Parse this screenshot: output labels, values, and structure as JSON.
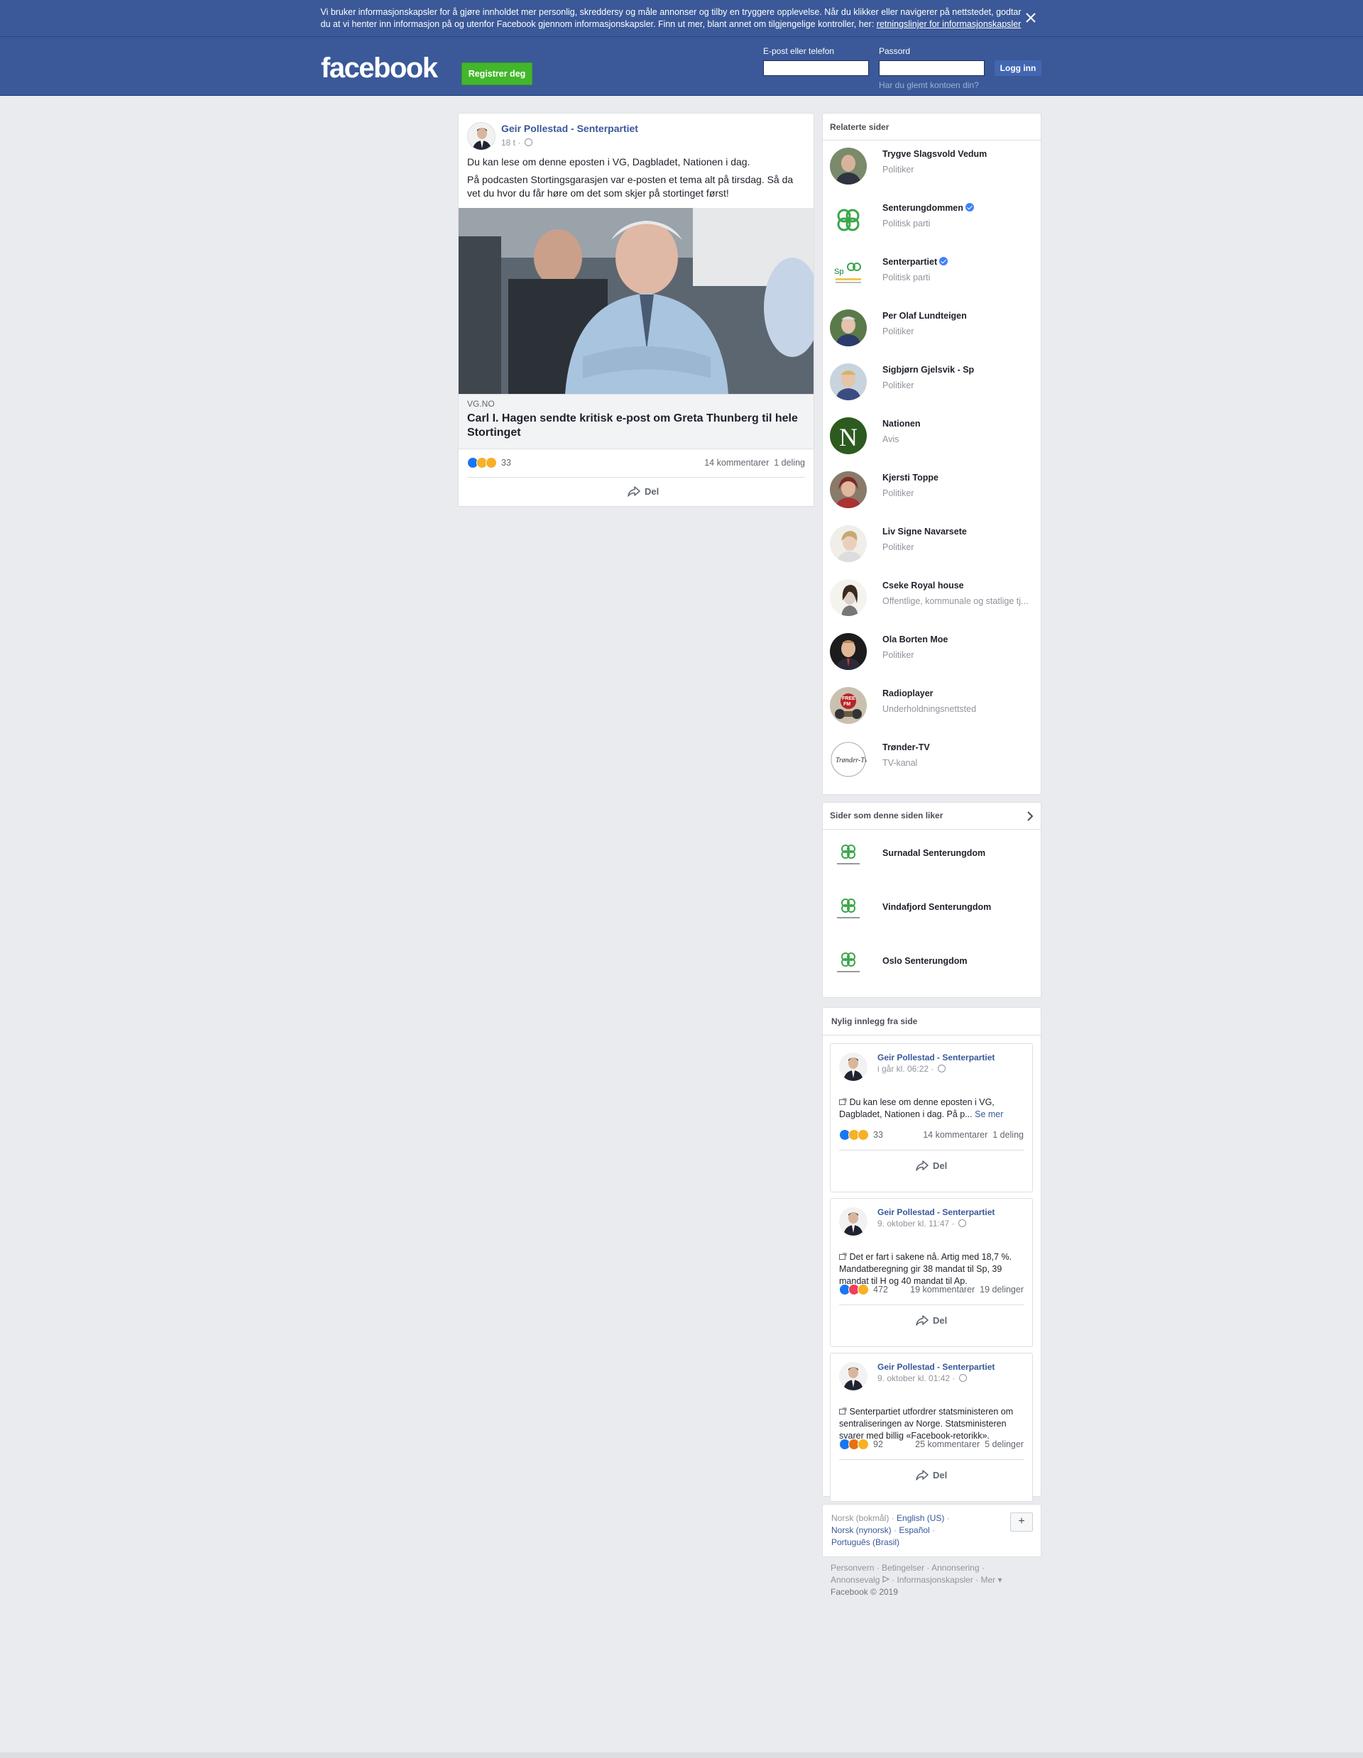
{
  "cookie_banner": {
    "text": "Vi bruker informasjonskapsler for å gjøre innholdet mer personlig, skreddersy og måle annonser og tilby en tryggere opplevelse. Når du klikker eller navigerer på nettstedet, godtar du at vi henter inn informasjon på og utenfor Facebook gjennom informasjonskapsler. Finn ut mer, blant annet om tilgjengelige kontroller, her: ",
    "link": "retningslinjer for informasjonskapsler"
  },
  "header": {
    "logo": "facebook",
    "register_label": "Registrer deg",
    "email_label": "E-post eller telefon",
    "password_label": "Passord",
    "login_label": "Logg inn",
    "forgot_label": "Har du glemt kontoen din?"
  },
  "post": {
    "author": "Geir Pollestad - Senterpartiet",
    "time": "18 t ·",
    "text1": "Du kan lese om denne eposten i VG, Dagbladet, Nationen i dag.",
    "text2": "På podcasten Stortingsgarasjen var e-posten et tema alt på tirsdag. Så da vet du hvor du får høre om det som skjer på stortinget først!",
    "link_domain": "VG.NO",
    "link_title": "Carl I. Hagen sendte kritisk e-post om Greta Thunberg til hele Stortinget",
    "reaction_count": "33",
    "comments": "14 kommentarer",
    "shares": "1 deling",
    "share_label": "Del"
  },
  "related": {
    "title": "Relaterte sider",
    "items": [
      {
        "name": "Trygve Slagsvold Vedum",
        "category": "Politiker",
        "verified": false
      },
      {
        "name": "Senterungdommen",
        "category": "Politisk parti",
        "verified": true
      },
      {
        "name": "Senterpartiet",
        "category": "Politisk parti",
        "verified": true
      },
      {
        "name": "Per Olaf Lundteigen",
        "category": "Politiker",
        "verified": false
      },
      {
        "name": "Sigbjørn Gjelsvik - Sp",
        "category": "Politiker",
        "verified": false
      },
      {
        "name": "Nationen",
        "category": "Avis",
        "verified": false
      },
      {
        "name": "Kjersti Toppe",
        "category": "Politiker",
        "verified": false
      },
      {
        "name": "Liv Signe Navarsete",
        "category": "Politiker",
        "verified": false
      },
      {
        "name": "Cseke Royal house",
        "category": "Offentlige, kommunale og statlige tj...",
        "verified": false
      },
      {
        "name": "Ola Borten Moe",
        "category": "Politiker",
        "verified": false
      },
      {
        "name": "Radioplayer",
        "category": "Underholdningsnettsted",
        "verified": false
      },
      {
        "name": "Trønder-TV",
        "category": "TV-kanal",
        "verified": false
      }
    ]
  },
  "liked_pages": {
    "title": "Sider som denne siden liker",
    "items": [
      "Surnadal Senterungdom",
      "Vindafjord Senterungdom",
      "Oslo Senterungdom"
    ]
  },
  "recent": {
    "title": "Nylig innlegg fra side",
    "see_more": "Se mer",
    "posts": [
      {
        "author": "Geir Pollestad - Senterpartiet",
        "time": "i går kl. 06:22 ·",
        "text": "Du kan lese om denne eposten i VG, Dagbladet, Nationen i dag. På p...",
        "reactions": "33",
        "comments": "14 kommentarer",
        "shares": "1 deling",
        "share_label": "Del"
      },
      {
        "author": "Geir Pollestad - Senterpartiet",
        "time": "9. oktober kl. 11:47 ·",
        "text": "Det er fart i sakene nå. Artig med 18,7 %. Mandatberegning gir 38 mandat til Sp, 39 mandat til H og 40 mandat til Ap.",
        "reactions": "472",
        "comments": "19 kommentarer",
        "shares": "19 delinger",
        "share_label": "Del"
      },
      {
        "author": "Geir Pollestad - Senterpartiet",
        "time": "9. oktober kl. 01:42 ·",
        "text": "Senterpartiet utfordrer statsministeren om sentraliseringen av Norge. Statsministeren svarer med billig «Facebook-retorikk».",
        "reactions": "92",
        "comments": "25 kommentarer",
        "shares": "5 delinger",
        "share_label": "Del"
      }
    ]
  },
  "languages": {
    "current": "Norsk (bokmål) ·",
    "english": "English (US)",
    "nynorsk": "Norsk (nynorsk)",
    "spanish": "Español",
    "portuguese": "Português (Brasil)",
    "plus": "+"
  },
  "footer": {
    "personvern": "Personvern",
    "betingelser": "Betingelser",
    "annonsering": "Annonsering",
    "annonsevalg": "Annonsevalg",
    "informasjonskapsler": "Informasjonskapsler",
    "mer": "Mer",
    "copyright": "Facebook © 2019"
  },
  "colors": {
    "brand": "#3b5998",
    "register": "#42b72a",
    "link": "#385898",
    "background": "#e9ebee"
  }
}
